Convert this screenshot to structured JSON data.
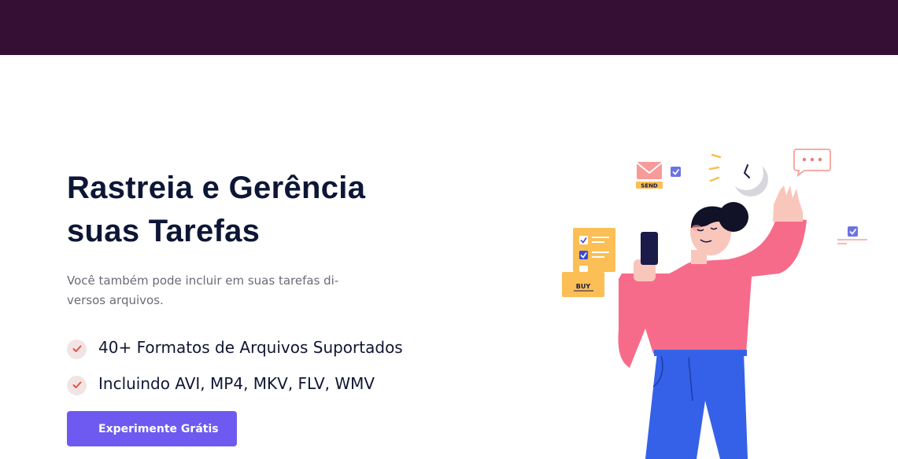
{
  "hero": {
    "title_line1": "Rastreia e Gerência",
    "title_line2": "suas Tarefas",
    "description": "Você também pode incluir em suas tarefas di-versos arquivos.",
    "features": [
      {
        "text": "40+ Formatos de Arquivos Suportados",
        "icon": "check-icon"
      },
      {
        "text": "Incluindo AVI, MP4, MKV, FLV, WMV",
        "icon": "check-icon"
      }
    ],
    "cta_label": "Experimente Grátis"
  },
  "illustration": {
    "send_label": "SEND",
    "buy_label": "BUY"
  },
  "colors": {
    "topbar": "#361034",
    "title": "#0d1636",
    "accent": "#6e5af0",
    "check": "#e2524b",
    "check_bg": "#f3e4e4",
    "shirt": "#f76b8a",
    "pants": "#3461e8"
  }
}
